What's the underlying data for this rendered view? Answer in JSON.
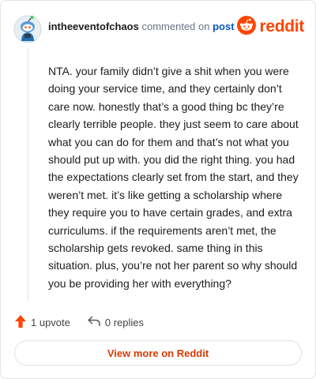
{
  "header": {
    "username": "intheeventofchaos",
    "action_text": "commented on",
    "post_link": "post",
    "brand_wordmark": "reddit"
  },
  "comment": {
    "body": "NTA. your family didn’t give a shit when you were doing your service time, and they certainly don’t care now. honestly that’s a good thing bc they’re clearly terrible people. they just seem to care about what you can do for them and that’s not what you should put up with. you did the right thing. you had the expectations clearly set from the start, and they weren’t met. it’s like getting a scholarship where they require you to have certain grades, and extra curriculums. if the requirements aren’t met, the scholarship gets revoked. same thing in this situation. plus, you’re not her parent so why should you be providing her with everything?"
  },
  "actions": {
    "upvote_label": "1 upvote",
    "replies_label": "0 replies"
  },
  "cta": {
    "label": "View more on Reddit"
  },
  "icons": {
    "avatar": "snoo-avatar-icon",
    "brand": "reddit-logo-icon",
    "upvote": "upvote-arrow-icon",
    "reply": "reply-arrow-icon"
  },
  "colors": {
    "brand": "#ff4500",
    "upvote": "#ff4500",
    "link": "#0b55c6",
    "cta_text": "#d93a00",
    "border": "#e3e3e3"
  }
}
